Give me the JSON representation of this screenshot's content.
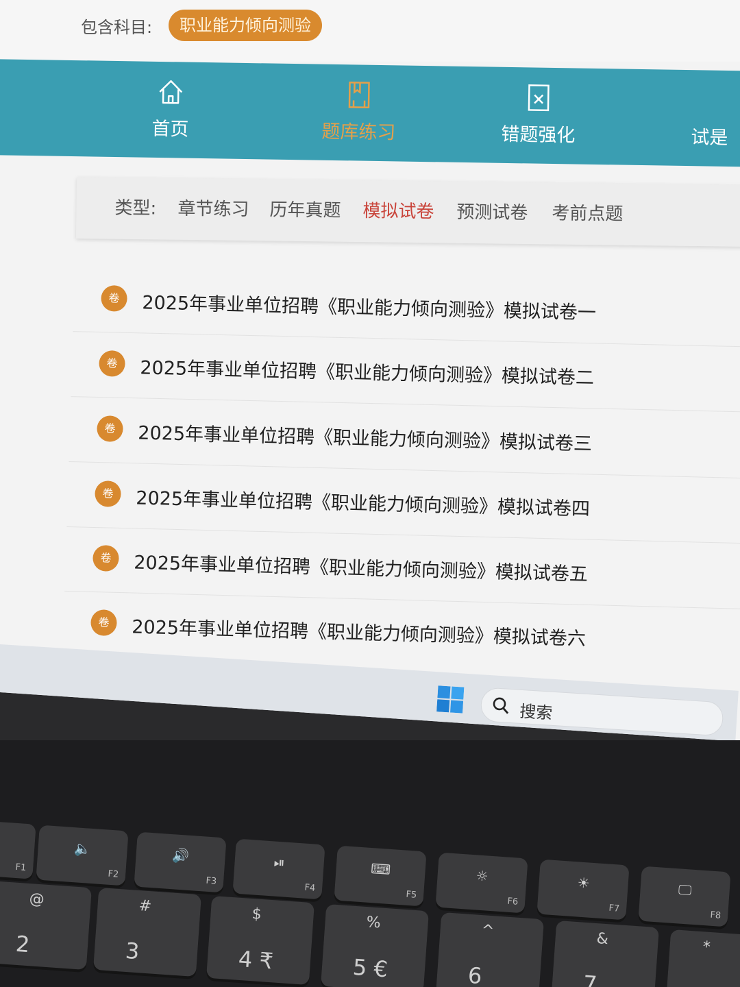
{
  "subject": {
    "label": "包含科目:",
    "selected": "职业能力倾向测验"
  },
  "nav": {
    "items": [
      {
        "label": "首页",
        "icon": "home-icon"
      },
      {
        "label": "题库练习",
        "icon": "bookmark-icon"
      },
      {
        "label": "错题强化",
        "icon": "wrong-doc-icon"
      },
      {
        "label": "试是",
        "icon": ""
      }
    ],
    "active": 1
  },
  "types": {
    "label": "类型:",
    "tabs": [
      "章节练习",
      "历年真题",
      "模拟试卷",
      "预测试卷",
      "考前点题"
    ],
    "active": 2
  },
  "papers": [
    {
      "badge": "卷",
      "title": "2025年事业单位招聘《职业能力倾向测验》模拟试卷一"
    },
    {
      "badge": "卷",
      "title": "2025年事业单位招聘《职业能力倾向测验》模拟试卷二"
    },
    {
      "badge": "卷",
      "title": "2025年事业单位招聘《职业能力倾向测验》模拟试卷三"
    },
    {
      "badge": "卷",
      "title": "2025年事业单位招聘《职业能力倾向测验》模拟试卷四"
    },
    {
      "badge": "卷",
      "title": "2025年事业单位招聘《职业能力倾向测验》模拟试卷五"
    },
    {
      "badge": "卷",
      "title": "2025年事业单位招聘《职业能力倾向测验》模拟试卷六"
    }
  ],
  "taskbar": {
    "search_placeholder": "搜索"
  },
  "keyboard": {
    "fn_keys": [
      {
        "fn": "F1",
        "icon": ""
      },
      {
        "fn": "F2",
        "icon": "🔈"
      },
      {
        "fn": "F3",
        "icon": "🔊"
      },
      {
        "fn": "F4",
        "icon": "⏯"
      },
      {
        "fn": "F5",
        "icon": "⌨"
      },
      {
        "fn": "F6",
        "icon": "☼"
      },
      {
        "fn": "F7",
        "icon": "☀"
      },
      {
        "fn": "F8",
        "icon": "🖵"
      }
    ],
    "num_keys": [
      {
        "top": "@",
        "main": "2"
      },
      {
        "top": "#",
        "main": "3"
      },
      {
        "top": "$",
        "main": "4 ₹"
      },
      {
        "top": "%",
        "main": "5 €"
      },
      {
        "top": "^",
        "main": "6"
      },
      {
        "top": "&",
        "main": "7"
      },
      {
        "top": "*",
        "main": ""
      }
    ]
  }
}
